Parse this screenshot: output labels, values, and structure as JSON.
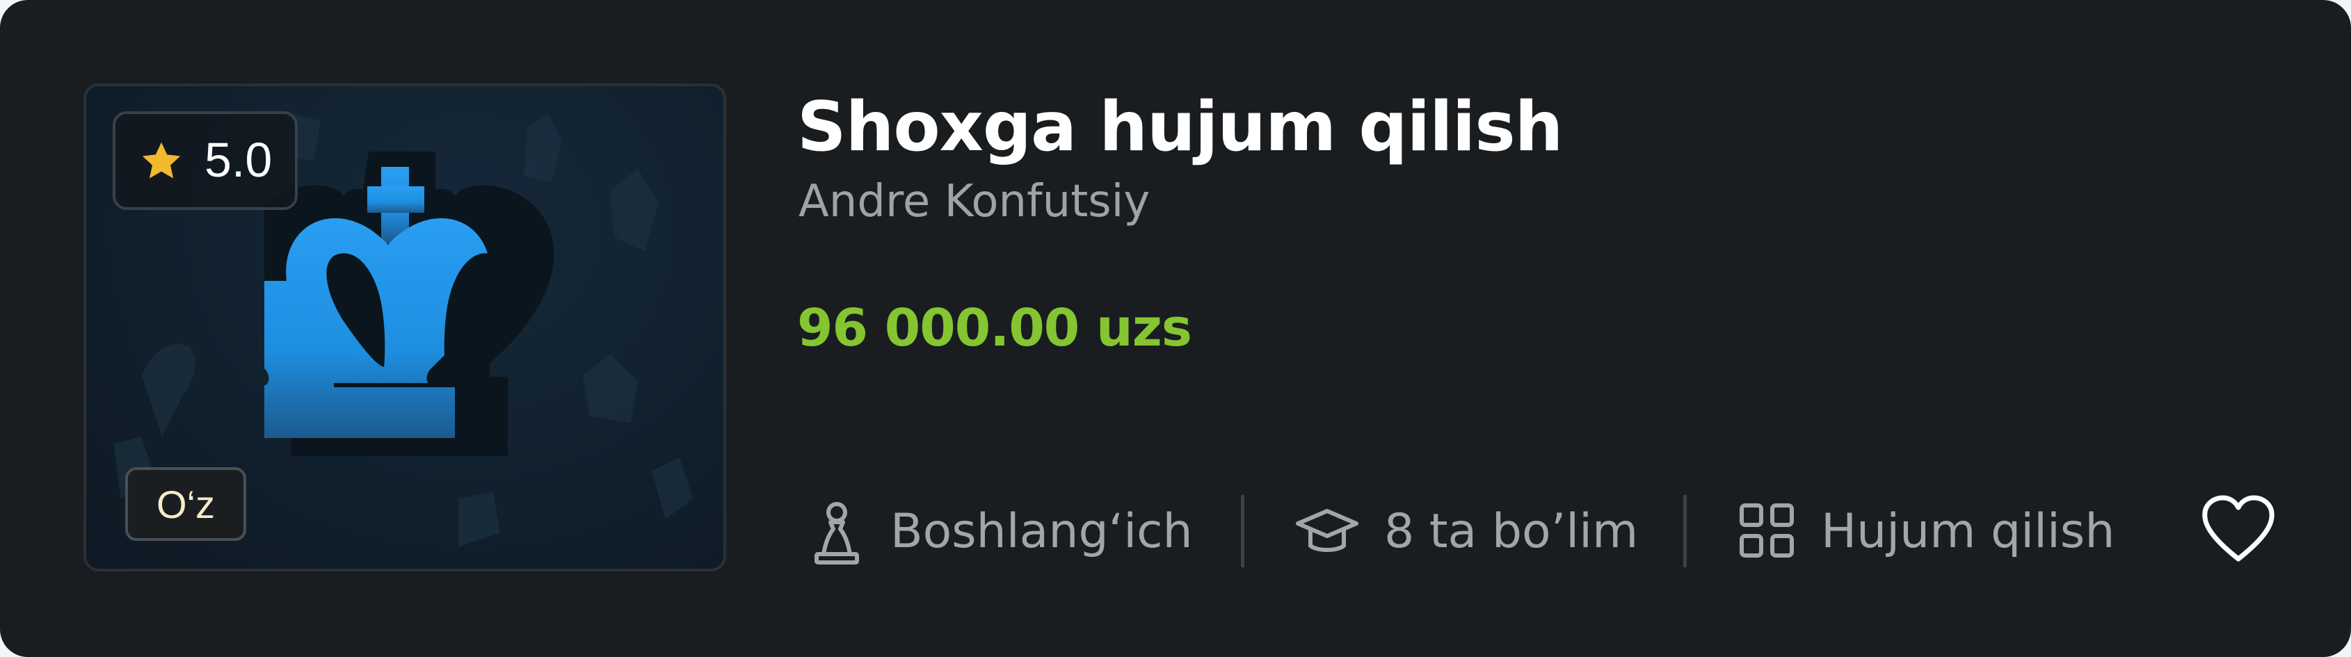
{
  "course": {
    "title": "Shoxga hujum qilish",
    "author": "Andre Konfutsiy",
    "price": "96 000.00 uzs",
    "rating": "5.0",
    "language": "O‘z"
  },
  "meta": {
    "level": "Boshlang‘ich",
    "sections": "8 ta bo’lim",
    "category": "Hujum qilish"
  },
  "icons": {
    "rating": "star-icon",
    "thumbnail": "chess-king-icon",
    "level": "chess-pawn-icon",
    "sections": "graduation-cap-icon",
    "category": "grid-icon",
    "favorite": "heart-icon"
  },
  "colors": {
    "background": "#1a1d20",
    "price": "#84c531",
    "star": "#f0b92e",
    "king": "#1e92e6",
    "muted_text": "#9ea3a8"
  }
}
